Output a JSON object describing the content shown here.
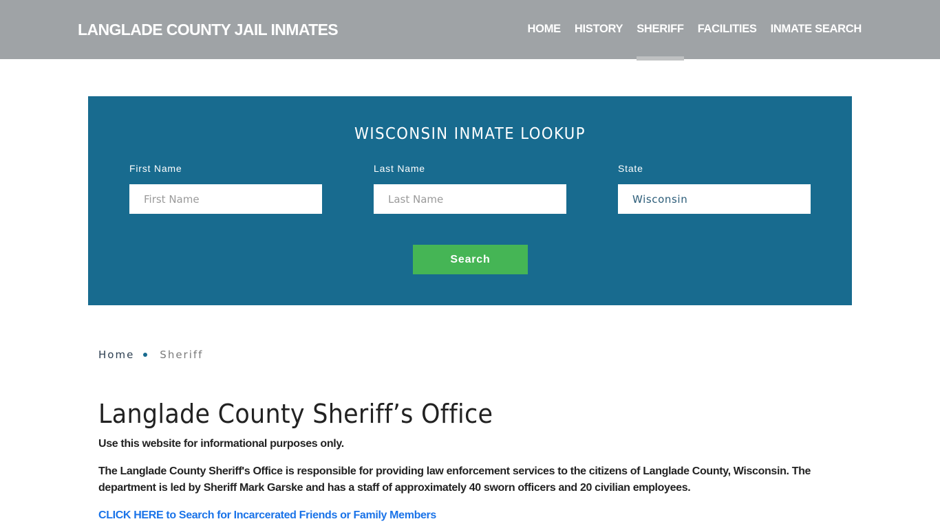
{
  "header": {
    "site_title": "LANGLADE COUNTY JAIL INMATES",
    "nav": [
      {
        "label": "HOME",
        "active": false
      },
      {
        "label": "HISTORY",
        "active": false
      },
      {
        "label": "SHERIFF",
        "active": true
      },
      {
        "label": "FACILITIES",
        "active": false
      },
      {
        "label": "INMATE SEARCH",
        "active": false
      }
    ]
  },
  "lookup": {
    "title": "WISCONSIN INMATE LOOKUP",
    "first_name": {
      "label": "First Name",
      "placeholder": "First Name",
      "value": ""
    },
    "last_name": {
      "label": "Last Name",
      "placeholder": "Last Name",
      "value": ""
    },
    "state": {
      "label": "State",
      "value": "Wisconsin"
    },
    "search_label": "Search"
  },
  "breadcrumb": {
    "home": "Home",
    "current": "Sheriff"
  },
  "content": {
    "title": "Langlade County Sheriff’s Office",
    "paragraphs": [
      "Use this website for informational purposes only.",
      "The Langlade County Sheriff's Office is responsible for providing law enforcement services to the citizens of Langlade County, Wisconsin. The department is led by Sheriff Mark Garske and has a staff of approximately 40 sworn officers and 20 civilian employees."
    ],
    "cta_link": "CLICK HERE to Search for Incarcerated Friends or Family Members"
  },
  "colors": {
    "header_bg": "#9fa3a6",
    "panel_bg": "#186b8f",
    "button_bg": "#45b555",
    "link": "#1a73e8"
  }
}
